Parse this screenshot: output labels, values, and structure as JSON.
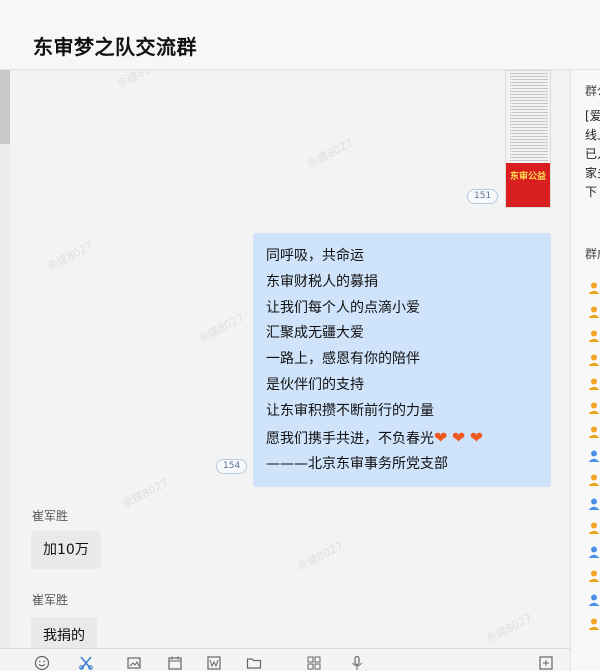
{
  "header": {
    "title": "东审梦之队交流群"
  },
  "watermark": "佘建8027",
  "chat": {
    "image_message": {
      "poster_text": "东审公益",
      "read_count": "151"
    },
    "text_message": {
      "lines": [
        "同呼吸，共命运",
        "东审财税人的募捐",
        "让我们每个人的点滴小爱",
        "汇聚成无疆大爱",
        "一路上，感恩有你的陪伴",
        "是伙伴们的支持",
        "让东审积攒不断前行的力量",
        "愿我们携手共进，不负春光",
        "———北京东审事务所党支部"
      ],
      "hearts": [
        "❤",
        "❤",
        "❤"
      ],
      "read_count": "154"
    },
    "messages": [
      {
        "sender": "崔军胜",
        "text": "加10万"
      },
      {
        "sender": "崔军胜",
        "text": "我捐的"
      }
    ]
  },
  "side_panel": {
    "notice_heading": "群公",
    "notice_lines": [
      "[爱",
      "线上",
      "已入",
      "家多",
      "下"
    ],
    "members_heading": "群成",
    "member_colors": [
      "#f0a31f",
      "#f0a31f",
      "#f0a31f",
      "#f0a31f",
      "#f0a31f",
      "#f0a31f",
      "#f0a31f",
      "#4a8fe6",
      "#f0a31f",
      "#4a8fe6",
      "#f0a31f",
      "#4a8fe6",
      "#f0a31f",
      "#4a8fe6",
      "#f0a31f"
    ]
  },
  "toolbar": {
    "tools": [
      "emoji-icon",
      "scissors-icon",
      "screenshot-icon",
      "calendar-icon",
      "word-icon",
      "folder-icon",
      "apps-icon",
      "microphone-icon",
      "expand-icon"
    ]
  }
}
